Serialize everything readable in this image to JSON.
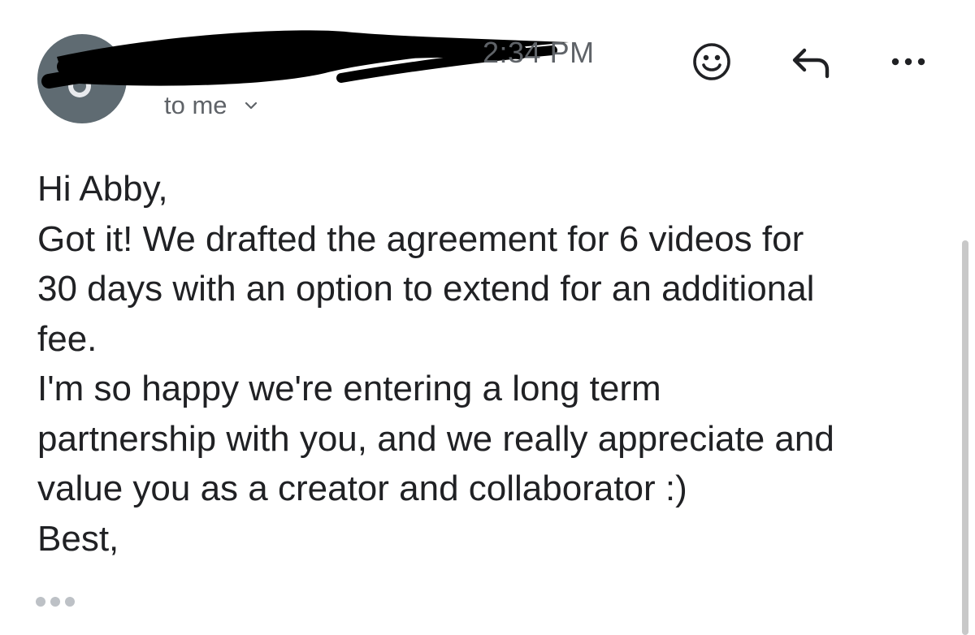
{
  "header": {
    "time": "2:34 PM",
    "recipient_label": "to me"
  },
  "toolbar": {
    "icons": [
      "emoji-reaction-icon",
      "reply-icon",
      "more-options-icon"
    ]
  },
  "message": {
    "lines": [
      "Hi Abby,",
      "Got it! We drafted the agreement for 6 videos for",
      "30 days with an option to extend for an additional",
      "fee.",
      "I'm so happy we're entering a long term",
      "partnership with you, and we really appreciate and",
      "value you as a creator and collaborator :)",
      "Best,"
    ]
  },
  "colors": {
    "avatar": "#5f6b72",
    "secondary_text": "#5f6368",
    "body_text": "#202124",
    "redaction": "#000000"
  }
}
